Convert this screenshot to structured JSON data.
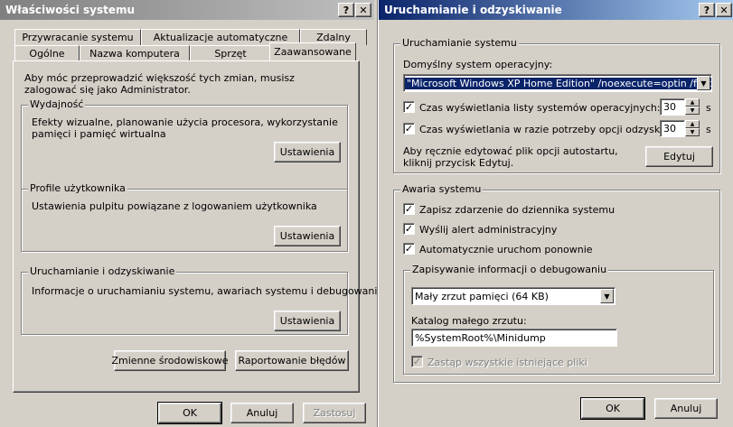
{
  "sys": {
    "title": "Właściwości systemu",
    "help": "?",
    "close": "✕",
    "tabs_top": [
      "Przywracanie systemu",
      "Aktualizacje automatyczne",
      "Zdalny"
    ],
    "tabs_bottom": [
      "Ogólne",
      "Nazwa komputera",
      "Sprzęt",
      "Zaawansowane"
    ],
    "intro": "Aby móc przeprowadzić większość tych zmian, musisz zalogować się jako Administrator.",
    "perf": {
      "label": "Wydajność",
      "desc": "Efekty wizualne, planowanie użycia procesora, wykorzystanie pamięci i pamięć wirtualna",
      "button": "Ustawienia"
    },
    "profiles": {
      "label": "Profile użytkownika",
      "desc": "Ustawienia pulpitu powiązane z logowaniem użytkownika",
      "button": "Ustawienia"
    },
    "startup": {
      "label": "Uruchamianie i odzyskiwanie",
      "desc": "Informacje o uruchamianiu systemu, awariach systemu i debugowaniu",
      "button": "Ustawienia"
    },
    "env_button": "Zmienne środowiskowe",
    "err_button": "Raportowanie błędów",
    "ok": "OK",
    "cancel": "Anuluj",
    "apply": "Zastosuj"
  },
  "startup_dlg": {
    "title": "Uruchamianie i odzyskiwanie",
    "help": "?",
    "close": "✕",
    "sys_start": {
      "label": "Uruchamianie systemu",
      "default_os_label": "Domyślny system operacyjny:",
      "default_os_value": "\"Microsoft Windows XP Home Edition\" /noexecute=optin /fastdetec",
      "show_list_label": "Czas wyświetlania listy systemów operacyjnych:",
      "show_list_checked": true,
      "show_list_value": "30",
      "show_recovery_label": "Czas wyświetlania w razie potrzeby opcji odzyskiwania",
      "show_recovery_checked": true,
      "show_recovery_value": "30",
      "unit": "s",
      "edit_hint": "Aby ręcznie edytować plik opcji autostartu, kliknij przycisk Edytuj.",
      "edit_button": "Edytuj"
    },
    "sys_failure": {
      "label": "Awaria systemu",
      "write_event": "Zapisz zdarzenie do dziennika systemu",
      "send_alert": "Wyślij alert administracyjny",
      "auto_restart": "Automatycznie uruchom ponownie",
      "debug": {
        "label": "Zapisywanie informacji o debugowaniu",
        "dump_type": "Mały zrzut pamięci (64 KB)",
        "dir_label": "Katalog małego zrzutu:",
        "dir_value": "%SystemRoot%\\Minidump",
        "overwrite": "Zastąp wszystkie istniejące pliki"
      }
    },
    "ok": "OK",
    "cancel": "Anuluj"
  }
}
